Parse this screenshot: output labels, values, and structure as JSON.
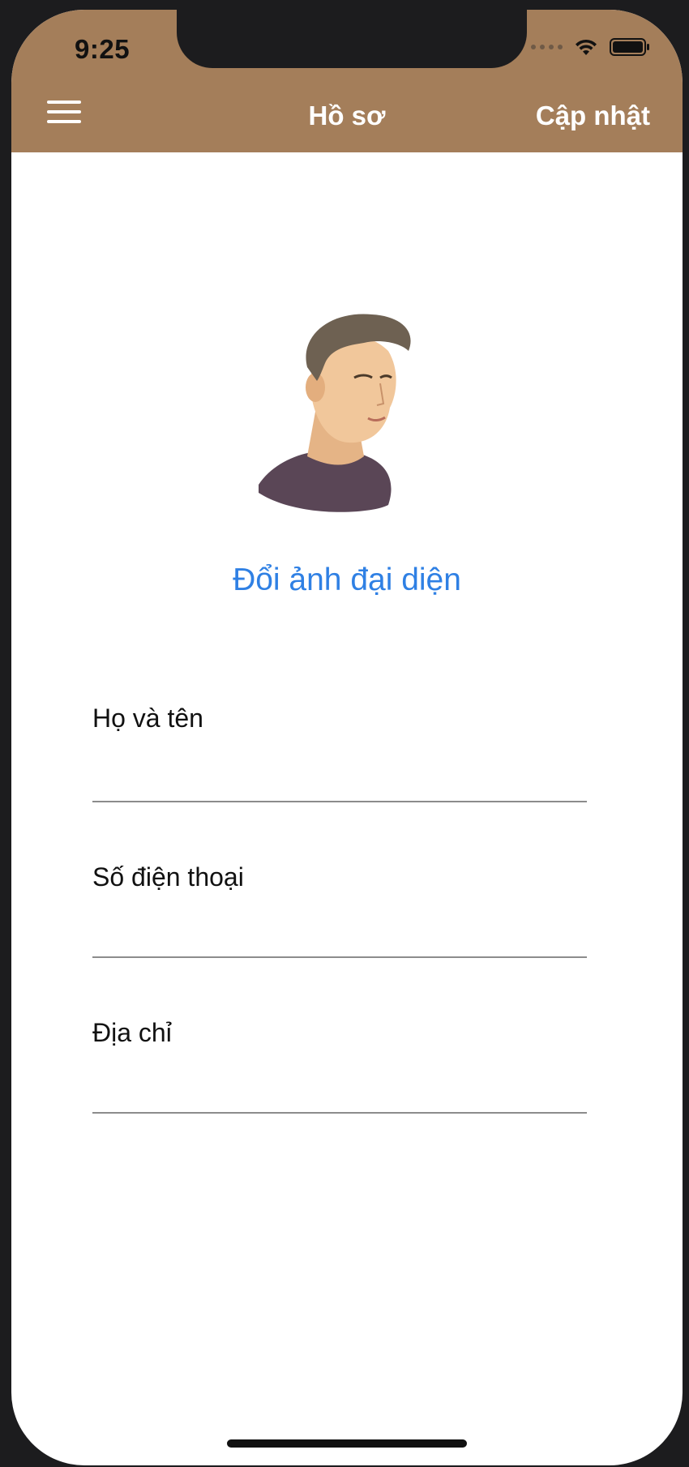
{
  "status_bar": {
    "time": "9:25",
    "icons": [
      "signal-dots-icon",
      "wifi-icon",
      "battery-icon"
    ]
  },
  "nav": {
    "menu_icon": "hamburger-menu-icon",
    "title": "Hồ sơ",
    "action_label": "Cập nhật"
  },
  "profile": {
    "avatar_alt": "avatar",
    "change_avatar_label": "Đổi ảnh đại diện"
  },
  "form": {
    "fields": [
      {
        "label": "Họ và tên",
        "value": ""
      },
      {
        "label": "Số điện thoại",
        "value": ""
      },
      {
        "label": "Địa chỉ",
        "value": ""
      }
    ]
  },
  "colors": {
    "header_bg": "#a47e5a",
    "link_blue": "#2f80e4",
    "background": "#ffffff"
  }
}
